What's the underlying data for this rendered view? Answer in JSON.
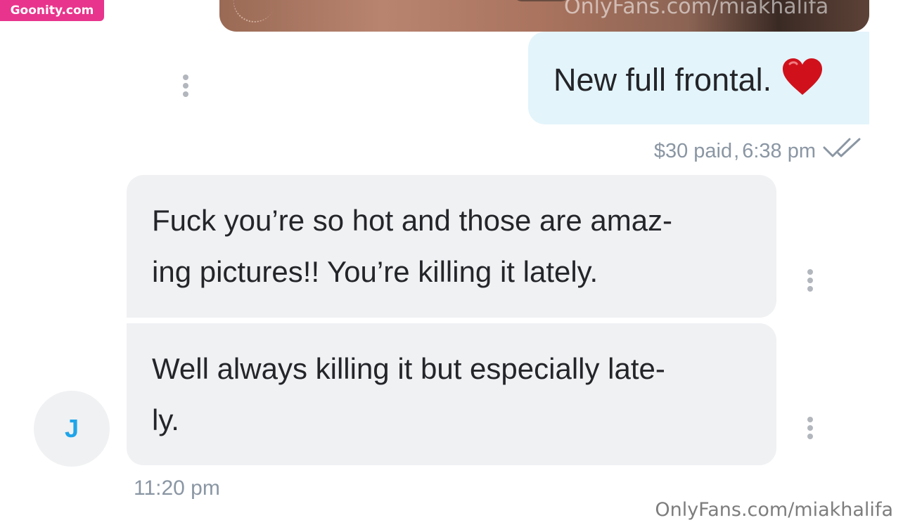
{
  "watermark_badge": "Goonity.com",
  "image_preview": {
    "watermark": "OnlyFans.com/miakhalifa"
  },
  "outgoing_message": {
    "text": "New full frontal.",
    "emoji": "heart",
    "paid": "$30 paid",
    "separator": ",",
    "time": "6:38 pm",
    "status_icon": "double-check-icon"
  },
  "incoming_messages": [
    {
      "lines": [
        "Fuck you’re so hot and those are amaz-",
        "ing pictures!! You’re killing it lately."
      ]
    },
    {
      "lines": [
        "Well always killing it but especially late-",
        "ly."
      ]
    }
  ],
  "avatar": {
    "initial": "J",
    "color": "#1ea5e9"
  },
  "incoming_time": "11:20 pm",
  "footer_watermark": "OnlyFans.com/miakhalifa",
  "colors": {
    "outgoing_bubble": "#e3f4fb",
    "incoming_bubble": "#f0f1f3",
    "meta_text": "#8a96a3",
    "badge": "#e8348c"
  }
}
